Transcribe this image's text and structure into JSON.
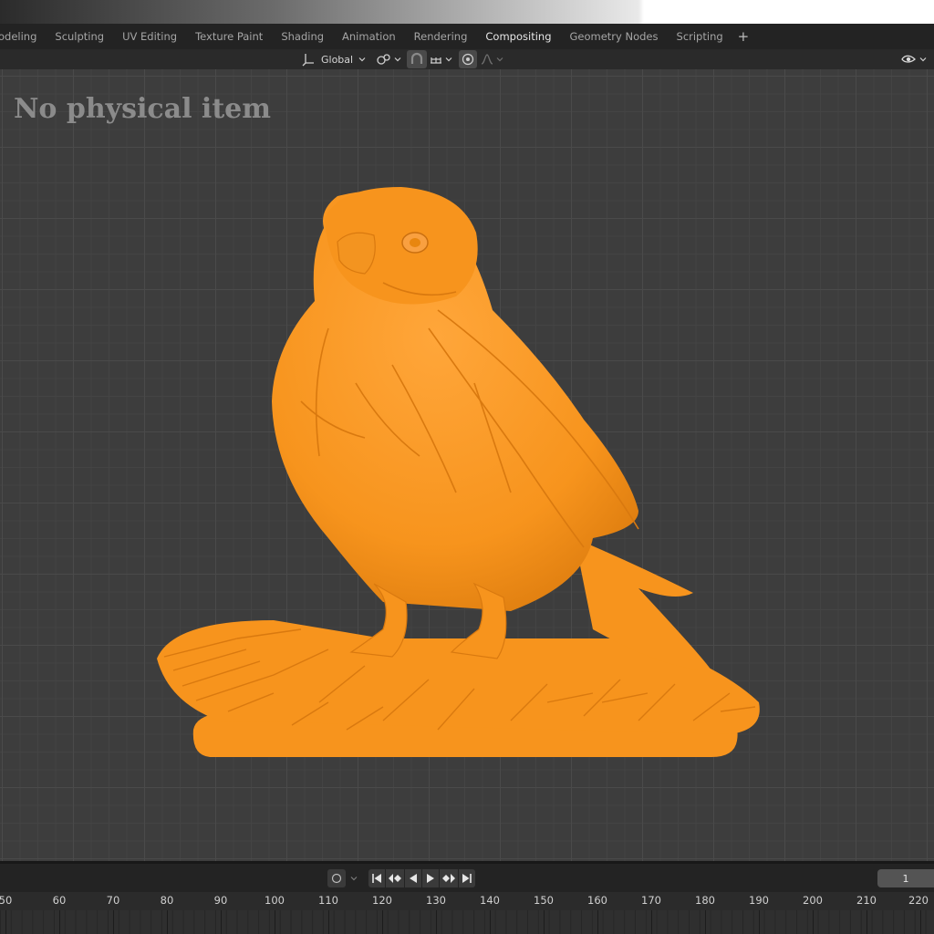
{
  "workspace_tabs": [
    "odeling",
    "Sculpting",
    "UV Editing",
    "Texture Paint",
    "Shading",
    "Animation",
    "Rendering",
    "Compositing",
    "Geometry Nodes",
    "Scripting"
  ],
  "active_tab": "Compositing",
  "add_tab_label": "+",
  "viewport_header": {
    "transform_orientation": "Global"
  },
  "overlay_text": "No physical item",
  "timeline": {
    "current_frame": "1",
    "ruler_labels": [
      "50",
      "60",
      "70",
      "80",
      "90",
      "100",
      "110",
      "120",
      "130",
      "140",
      "150",
      "160",
      "170",
      "180",
      "190",
      "200",
      "210",
      "220"
    ]
  },
  "colors": {
    "model": "#f7941d",
    "viewport_bg": "#3d3d3d",
    "header_bg": "#2a2a2a"
  }
}
